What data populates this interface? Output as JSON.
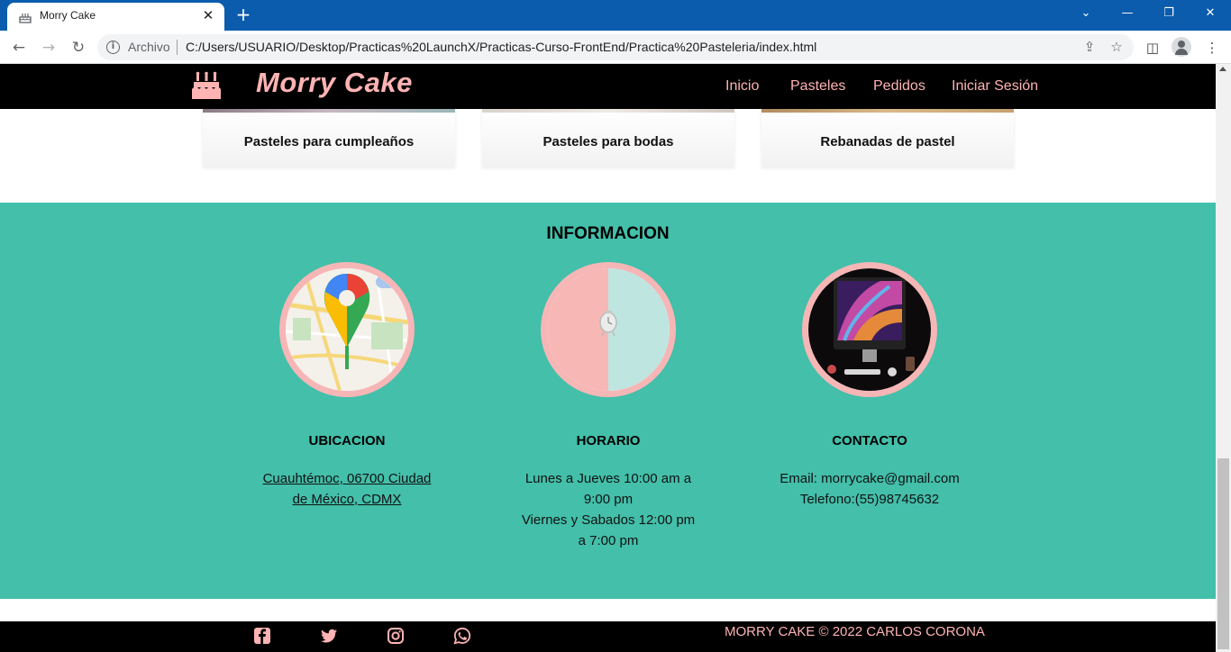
{
  "browser": {
    "tab_title": "Morry Cake",
    "tab_close": "✕",
    "new_tab": "+",
    "scheme_label": "Archivo",
    "url": "C:/Users/USUARIO/Desktop/Practicas%20LaunchX/Practicas-Curso-FrontEnd/Practica%20Pasteleria/index.html",
    "icons": [
      "back-icon",
      "forward-icon",
      "reload-icon",
      "info-icon",
      "share-icon",
      "star-icon",
      "side-panel-icon",
      "profile-icon",
      "menu-icon"
    ]
  },
  "header": {
    "logo_text": "Morry Cake",
    "nav": [
      "Inicio",
      "Pasteles",
      "Pedidos",
      "Iniciar Sesión"
    ]
  },
  "cards": [
    {
      "title": "Pasteles para cumpleaños"
    },
    {
      "title": "Pasteles para bodas"
    },
    {
      "title": "Rebanadas de pastel"
    }
  ],
  "info": {
    "title": "INFORMACION",
    "columns": [
      {
        "title": "UBICACION",
        "line1": "Cuauhtémoc, 06700 Ciudad",
        "line2": "de México, CDMX"
      },
      {
        "title": "HORARIO",
        "line1": "Lunes a Jueves 10:00 am a",
        "line2": "9:00 pm",
        "line3": "Viernes y Sabados 12:00 pm",
        "line4": "a 7:00 pm"
      },
      {
        "title": "CONTACTO",
        "line1": "Email: morrycake@gmail.com",
        "line2": "Telefono:(55)98745632"
      }
    ]
  },
  "footer": {
    "copyright": "MORRY CAKE © 2022 CARLOS CORONA",
    "social_icons": [
      "facebook-icon",
      "twitter-icon",
      "instagram-icon",
      "whatsapp-icon"
    ]
  },
  "colors": {
    "header_bg": "#000000",
    "accent_pink": "#ffb3b3",
    "info_bg": "#43bfaa",
    "circle_border": "#f7b6b6"
  }
}
